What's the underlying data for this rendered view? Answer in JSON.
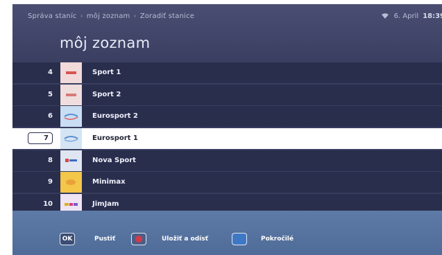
{
  "header": {
    "breadcrumb": [
      "Správa staníc",
      "môj zoznam",
      "Zoradiť stanice"
    ],
    "date": "6. April",
    "time": "18:39"
  },
  "title": "môj zoznam",
  "channels": [
    {
      "number": "4",
      "name": "Sport 1",
      "logo": "sport1-logo",
      "selected": false
    },
    {
      "number": "5",
      "name": "Sport 2",
      "logo": "sport2-logo",
      "selected": false
    },
    {
      "number": "6",
      "name": "Eurosport 2",
      "logo": "eurosport2-logo",
      "selected": false
    },
    {
      "number": "7",
      "name": "Eurosport 1",
      "logo": "eurosport1-logo",
      "selected": true
    },
    {
      "number": "8",
      "name": "Nova Sport",
      "logo": "novasport-logo",
      "selected": false
    },
    {
      "number": "9",
      "name": "Minimax",
      "logo": "minimax-logo",
      "selected": false
    },
    {
      "number": "10",
      "name": "JimJam",
      "logo": "jimjam-logo",
      "selected": false
    }
  ],
  "footer": {
    "ok_key": "OK",
    "ok_label": "Pustiť",
    "red_label": "Uložiť a odísť",
    "blue_label": "Pokročilé"
  },
  "colors": {
    "background": "#3b3f62",
    "row": "#2a2e4d",
    "selected_row": "#ffffff",
    "footer": "#5672a0",
    "red_key": "#d4394b",
    "blue_key": "#3e78c4"
  }
}
